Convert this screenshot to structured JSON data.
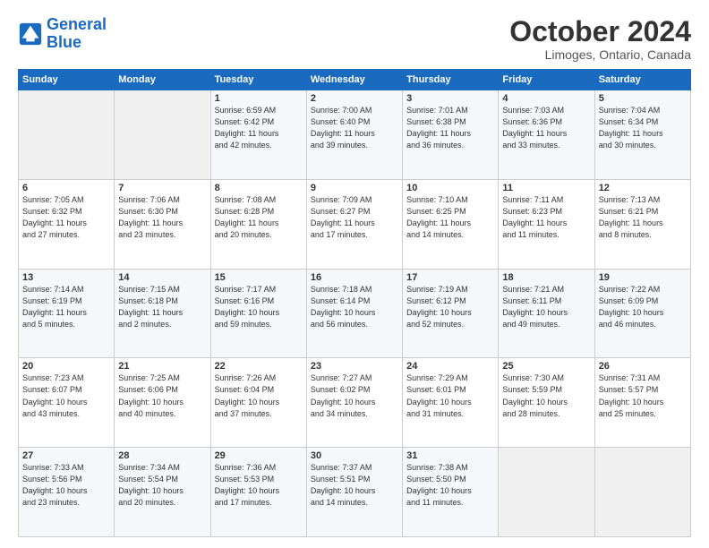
{
  "header": {
    "logo_line1": "General",
    "logo_line2": "Blue",
    "month": "October 2024",
    "location": "Limoges, Ontario, Canada"
  },
  "days_of_week": [
    "Sunday",
    "Monday",
    "Tuesday",
    "Wednesday",
    "Thursday",
    "Friday",
    "Saturday"
  ],
  "weeks": [
    [
      {
        "day": "",
        "info": ""
      },
      {
        "day": "",
        "info": ""
      },
      {
        "day": "1",
        "info": "Sunrise: 6:59 AM\nSunset: 6:42 PM\nDaylight: 11 hours\nand 42 minutes."
      },
      {
        "day": "2",
        "info": "Sunrise: 7:00 AM\nSunset: 6:40 PM\nDaylight: 11 hours\nand 39 minutes."
      },
      {
        "day": "3",
        "info": "Sunrise: 7:01 AM\nSunset: 6:38 PM\nDaylight: 11 hours\nand 36 minutes."
      },
      {
        "day": "4",
        "info": "Sunrise: 7:03 AM\nSunset: 6:36 PM\nDaylight: 11 hours\nand 33 minutes."
      },
      {
        "day": "5",
        "info": "Sunrise: 7:04 AM\nSunset: 6:34 PM\nDaylight: 11 hours\nand 30 minutes."
      }
    ],
    [
      {
        "day": "6",
        "info": "Sunrise: 7:05 AM\nSunset: 6:32 PM\nDaylight: 11 hours\nand 27 minutes."
      },
      {
        "day": "7",
        "info": "Sunrise: 7:06 AM\nSunset: 6:30 PM\nDaylight: 11 hours\nand 23 minutes."
      },
      {
        "day": "8",
        "info": "Sunrise: 7:08 AM\nSunset: 6:28 PM\nDaylight: 11 hours\nand 20 minutes."
      },
      {
        "day": "9",
        "info": "Sunrise: 7:09 AM\nSunset: 6:27 PM\nDaylight: 11 hours\nand 17 minutes."
      },
      {
        "day": "10",
        "info": "Sunrise: 7:10 AM\nSunset: 6:25 PM\nDaylight: 11 hours\nand 14 minutes."
      },
      {
        "day": "11",
        "info": "Sunrise: 7:11 AM\nSunset: 6:23 PM\nDaylight: 11 hours\nand 11 minutes."
      },
      {
        "day": "12",
        "info": "Sunrise: 7:13 AM\nSunset: 6:21 PM\nDaylight: 11 hours\nand 8 minutes."
      }
    ],
    [
      {
        "day": "13",
        "info": "Sunrise: 7:14 AM\nSunset: 6:19 PM\nDaylight: 11 hours\nand 5 minutes."
      },
      {
        "day": "14",
        "info": "Sunrise: 7:15 AM\nSunset: 6:18 PM\nDaylight: 11 hours\nand 2 minutes."
      },
      {
        "day": "15",
        "info": "Sunrise: 7:17 AM\nSunset: 6:16 PM\nDaylight: 10 hours\nand 59 minutes."
      },
      {
        "day": "16",
        "info": "Sunrise: 7:18 AM\nSunset: 6:14 PM\nDaylight: 10 hours\nand 56 minutes."
      },
      {
        "day": "17",
        "info": "Sunrise: 7:19 AM\nSunset: 6:12 PM\nDaylight: 10 hours\nand 52 minutes."
      },
      {
        "day": "18",
        "info": "Sunrise: 7:21 AM\nSunset: 6:11 PM\nDaylight: 10 hours\nand 49 minutes."
      },
      {
        "day": "19",
        "info": "Sunrise: 7:22 AM\nSunset: 6:09 PM\nDaylight: 10 hours\nand 46 minutes."
      }
    ],
    [
      {
        "day": "20",
        "info": "Sunrise: 7:23 AM\nSunset: 6:07 PM\nDaylight: 10 hours\nand 43 minutes."
      },
      {
        "day": "21",
        "info": "Sunrise: 7:25 AM\nSunset: 6:06 PM\nDaylight: 10 hours\nand 40 minutes."
      },
      {
        "day": "22",
        "info": "Sunrise: 7:26 AM\nSunset: 6:04 PM\nDaylight: 10 hours\nand 37 minutes."
      },
      {
        "day": "23",
        "info": "Sunrise: 7:27 AM\nSunset: 6:02 PM\nDaylight: 10 hours\nand 34 minutes."
      },
      {
        "day": "24",
        "info": "Sunrise: 7:29 AM\nSunset: 6:01 PM\nDaylight: 10 hours\nand 31 minutes."
      },
      {
        "day": "25",
        "info": "Sunrise: 7:30 AM\nSunset: 5:59 PM\nDaylight: 10 hours\nand 28 minutes."
      },
      {
        "day": "26",
        "info": "Sunrise: 7:31 AM\nSunset: 5:57 PM\nDaylight: 10 hours\nand 25 minutes."
      }
    ],
    [
      {
        "day": "27",
        "info": "Sunrise: 7:33 AM\nSunset: 5:56 PM\nDaylight: 10 hours\nand 23 minutes."
      },
      {
        "day": "28",
        "info": "Sunrise: 7:34 AM\nSunset: 5:54 PM\nDaylight: 10 hours\nand 20 minutes."
      },
      {
        "day": "29",
        "info": "Sunrise: 7:36 AM\nSunset: 5:53 PM\nDaylight: 10 hours\nand 17 minutes."
      },
      {
        "day": "30",
        "info": "Sunrise: 7:37 AM\nSunset: 5:51 PM\nDaylight: 10 hours\nand 14 minutes."
      },
      {
        "day": "31",
        "info": "Sunrise: 7:38 AM\nSunset: 5:50 PM\nDaylight: 10 hours\nand 11 minutes."
      },
      {
        "day": "",
        "info": ""
      },
      {
        "day": "",
        "info": ""
      }
    ]
  ]
}
